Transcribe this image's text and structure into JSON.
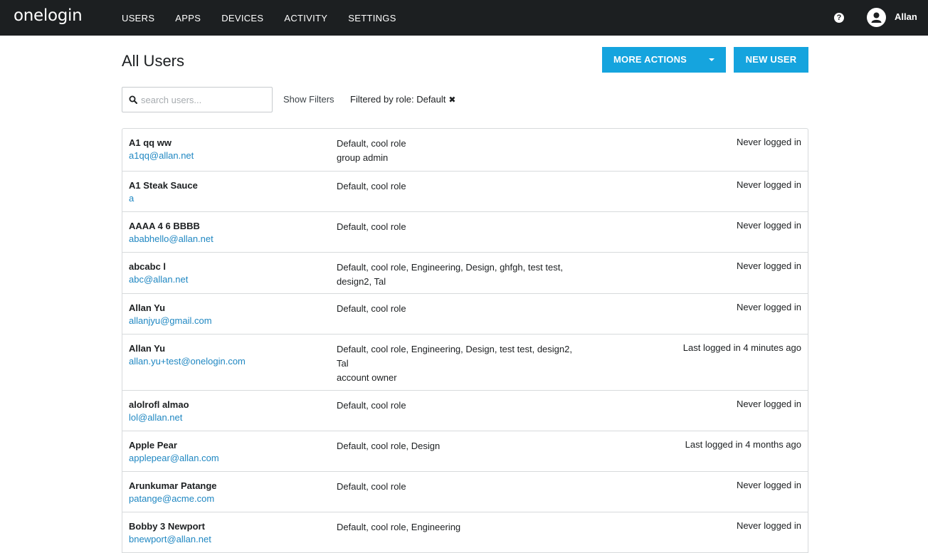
{
  "app": {
    "logo": "onelogin"
  },
  "nav": {
    "items": [
      "USERS",
      "APPS",
      "DEVICES",
      "ACTIVITY",
      "SETTINGS"
    ]
  },
  "topbar": {
    "help": "?",
    "user": "Allan"
  },
  "page": {
    "title": "All Users"
  },
  "actions": {
    "more_actions": "MORE ACTIONS",
    "new_user": "NEW USER"
  },
  "search": {
    "placeholder": "search users..."
  },
  "filters": {
    "show_filters": "Show Filters",
    "active_filter": "Filtered by role: Default"
  },
  "colors": {
    "topbar": "#1c1f21",
    "accent": "#15a4de",
    "link": "#1f87c2"
  },
  "users": [
    {
      "name": "A1 qq ww",
      "email": "a1qq@allan.net",
      "roles": [
        "Default, cool role",
        "group admin"
      ],
      "login": "Never logged in"
    },
    {
      "name": "A1 Steak Sauce",
      "email": "a",
      "roles": [
        "Default, cool role"
      ],
      "login": "Never logged in"
    },
    {
      "name": "AAAA 4 6 BBBB",
      "email": "ababhello@allan.net",
      "roles": [
        "Default, cool role"
      ],
      "login": "Never logged in"
    },
    {
      "name": "abcabc l",
      "email": "abc@allan.net",
      "roles": [
        "Default, cool role, Engineering, Design, ghfgh, test test,",
        "design2, Tal"
      ],
      "login": "Never logged in"
    },
    {
      "name": "Allan Yu",
      "email": "allanjyu@gmail.com",
      "roles": [
        "Default, cool role"
      ],
      "login": "Never logged in"
    },
    {
      "name": "Allan Yu",
      "email": "allan.yu+test@onelogin.com",
      "roles": [
        "Default, cool role, Engineering, Design, test test, design2,",
        "Tal",
        "account owner"
      ],
      "login": "Last logged in 4 minutes ago"
    },
    {
      "name": "alolrofl almao",
      "email": "lol@allan.net",
      "roles": [
        "Default, cool role"
      ],
      "login": "Never logged in"
    },
    {
      "name": "Apple Pear",
      "email": "applepear@allan.com",
      "roles": [
        "Default, cool role, Design"
      ],
      "login": "Last logged in 4 months ago"
    },
    {
      "name": "Arunkumar Patange",
      "email": "patange@acme.com",
      "roles": [
        "Default, cool role"
      ],
      "login": "Never logged in"
    },
    {
      "name": "Bobby 3 Newport",
      "email": "bnewport@allan.net",
      "roles": [
        "Default, cool role, Engineering"
      ],
      "login": "Never logged in"
    }
  ]
}
